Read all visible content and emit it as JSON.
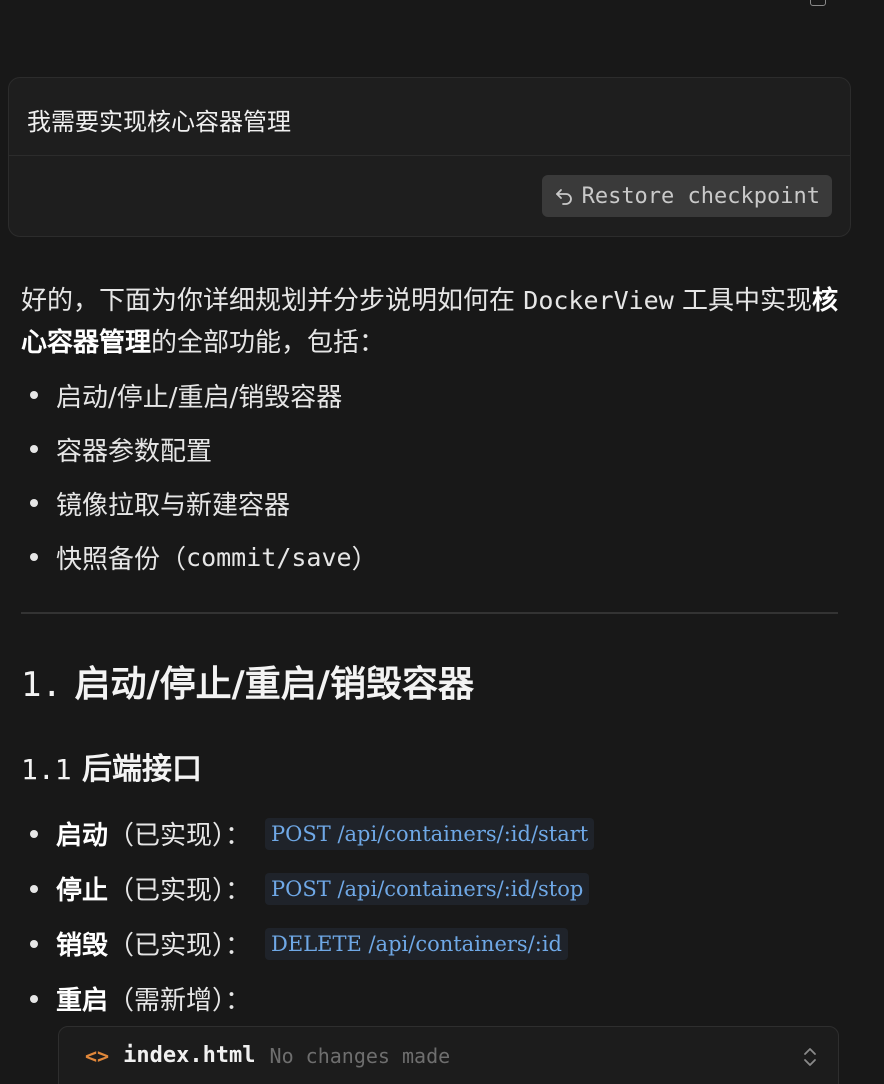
{
  "user_message": {
    "text": "我需要实现核心容器管理",
    "restore_label": "Restore checkpoint"
  },
  "assistant": {
    "intro_part1": "好的，下面为你详细规划并分步说明如何在 ",
    "intro_code": "DockerView",
    "intro_part2": " 工具中实现",
    "intro_bold": "核心容器管理",
    "intro_part3": "的全部功能，包括：",
    "bullets": [
      "启动/停止/重启/销毁容器",
      "容器参数配置",
      "镜像拉取与新建容器"
    ],
    "bullet4_text": "快照备份（",
    "bullet4_code": "commit/save",
    "bullet4_close": "）",
    "heading1_num": "1.",
    "heading1_text": "启动/停止/重启/销毁容器",
    "heading2_num": "1.1",
    "heading2_text": "后端接口",
    "api_items": [
      {
        "label": "启动",
        "note": "（已实现）：",
        "code": "POST /api/containers/:id/start"
      },
      {
        "label": "停止",
        "note": "（已实现）：",
        "code": "POST /api/containers/:id/stop"
      },
      {
        "label": "销毁",
        "note": "（已实现）：",
        "code": "DELETE /api/containers/:id"
      },
      {
        "label": "重启",
        "note": "（需新增）：",
        "code": ""
      }
    ]
  },
  "code_block": {
    "icon": "<>",
    "filename": "index.html",
    "status": "No changes made"
  },
  "colors": {
    "background": "#181818",
    "card": "#1e1e1e",
    "code_inline": "#6fa8e6",
    "file_icon": "#e0873a"
  }
}
